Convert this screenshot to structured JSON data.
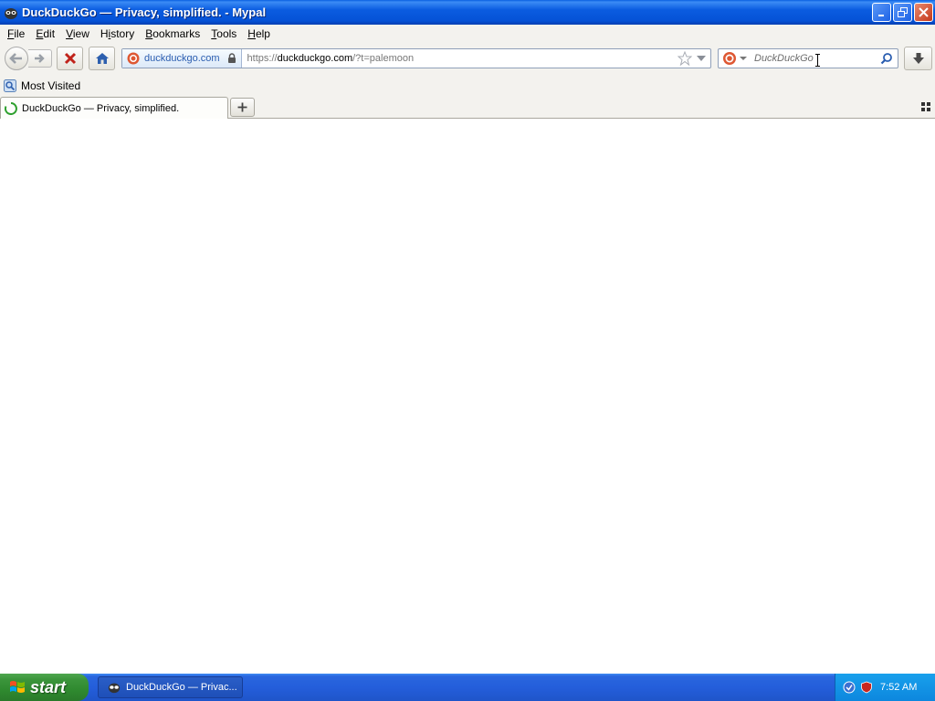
{
  "window": {
    "title": "DuckDuckGo — Privacy, simplified. - Mypal"
  },
  "menu": {
    "items": [
      "File",
      "Edit",
      "View",
      "History",
      "Bookmarks",
      "Tools",
      "Help"
    ],
    "mnemonics": [
      "F",
      "E",
      "V",
      "i",
      "B",
      "T",
      "H"
    ]
  },
  "navbar": {
    "identity_label": "duckduckgo.com",
    "url_scheme": "https://",
    "url_host": "duckduckgo.com",
    "url_rest": "/?t=palemoon",
    "search_placeholder": "DuckDuckGo"
  },
  "bookmarks": {
    "items": [
      {
        "label": "Most Visited",
        "icon": "most-visited-icon"
      }
    ]
  },
  "tabs": [
    {
      "title": "DuckDuckGo — Privacy, simplified.",
      "loading": true
    }
  ],
  "taskbar": {
    "start_label": "start",
    "tasks": [
      {
        "label": "DuckDuckGo — Privac..."
      }
    ],
    "clock": "7:52 AM"
  },
  "colors": {
    "titlebar": "#0552d6",
    "start_green": "#3c963c",
    "tray_blue": "#0d87de",
    "loading_spinner": "#2ea02e"
  }
}
